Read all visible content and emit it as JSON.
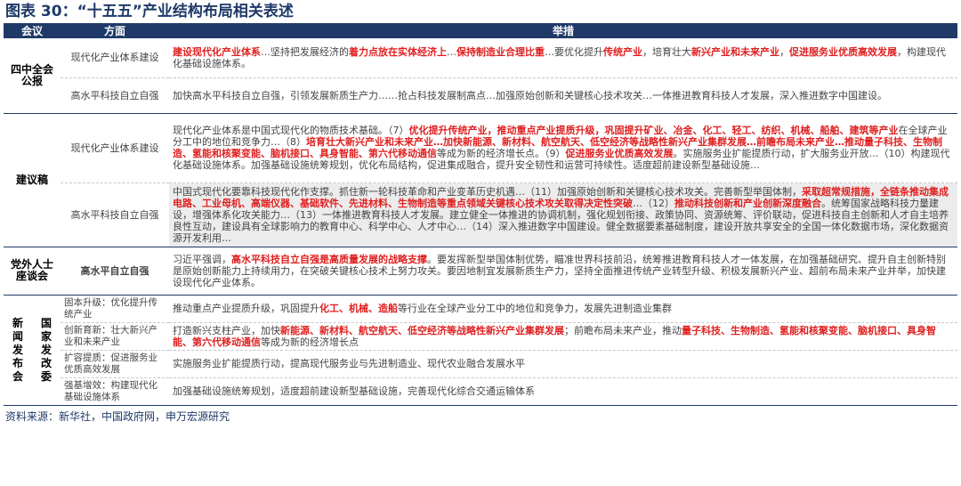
{
  "title": "图表 30：“十五五”产业结构布局相关表述",
  "headers": {
    "meeting": "会议",
    "aspect": "方面",
    "measures": "举措"
  },
  "rows": [
    {
      "meeting": "四中全会公报",
      "aspects": [
        {
          "aspect": "现代化产业体系建设",
          "segments": [
            {
              "t": "建设现代化产业体系",
              "hl": true
            },
            {
              "t": "…坚持把发展经济的",
              "hl": false
            },
            {
              "t": "着力点放在实体经济上",
              "hl": true
            },
            {
              "t": "…",
              "hl": false
            },
            {
              "t": "保持制造业合理比重",
              "hl": true
            },
            {
              "t": "…要优化提升",
              "hl": false
            },
            {
              "t": "传统产业",
              "hl": true
            },
            {
              "t": "，培育壮大",
              "hl": false
            },
            {
              "t": "新兴产业和未来产业",
              "hl": true
            },
            {
              "t": "，",
              "hl": false
            },
            {
              "t": "促进服务业优质高效发展",
              "hl": true
            },
            {
              "t": "，构建现代化基础设施体系。",
              "hl": false
            }
          ]
        },
        {
          "aspect": "高水平科技自立自强",
          "segments": [
            {
              "t": "加快高水平科技自立自强，引领发展新质生产力……抢占科技发展制高点…加强原始创新和关键核心技术攻关…一体推进教育科技人才发展，深入推进数字中国建设。",
              "hl": false
            }
          ]
        }
      ]
    },
    {
      "meeting": "建议稿",
      "aspects": [
        {
          "aspect": "现代化产业体系建设",
          "segments": [
            {
              "t": "现代化产业体系是中国式现代化的物质技术基础。（7）",
              "hl": false
            },
            {
              "t": "优化提升传统产业，推动重点产业提质升级，巩固提升矿业、冶金、化工、轻工、纺织、机械、船舶、建筑等产业",
              "hl": true
            },
            {
              "t": "在全球产业分工中的地位和竞争力…（8）",
              "hl": false
            },
            {
              "t": "培育壮大新兴产业和未来产业…加快新能源、新材料、航空航天、低空经济等战略性新兴产业集群发展…前瞻布局未来产业…推动量子科技、生物制造、氢能和核聚变能、脑机接口、具身智能、第六代移动通信",
              "hl": true
            },
            {
              "t": "等成为新的经济增长点。（9）",
              "hl": false
            },
            {
              "t": "促进服务业优质高效发展",
              "hl": true
            },
            {
              "t": "。实施服务业扩能提质行动，扩大服务业开放…（10）构建现代化基础设施体系。加强基础设施统筹规划，优化布局结构，促进集成融合，提升安全韧性和运营可持续性。适度超前建设新型基础设施…",
              "hl": false
            }
          ]
        },
        {
          "aspect": "高水平科技自立自强",
          "segments": [
            {
              "t": "中国式现代化要靠科技现代化作支撑。抓住新一轮科技革命和产业变革历史机遇…（11）加强原始创新和关键核心技术攻关。完善新型举国体制，",
              "hl": false
            },
            {
              "t": "采取超常规措施，全链条推动集成电路、工业母机、高端仪器、基础软件、先进材料、生物制造等重点领域关键核心技术攻关取得决定性突破",
              "hl": true
            },
            {
              "t": "…（12）",
              "hl": false
            },
            {
              "t": "推动科技创新和产业创新深度融合",
              "hl": true
            },
            {
              "t": "。统筹国家战略科技力量建设，增强体系化攻关能力…（13）一体推进教育科技人才发展。建立健全一体推进的协调机制，强化规划衔接、政策协同、资源统筹、评价联动，促进科技自主创新和人才自主培养良性互动，建设具有全球影响力的教育中心、科学中心、人才中心…（14）深入推进数字中国建设。健全数据要素基础制度，建设开放共享安全的全国一体化数据市场，深化数据资源开发利用…",
              "hl": false
            }
          ]
        }
      ]
    },
    {
      "meeting": "党外人士座谈会",
      "aspects": [
        {
          "aspect": "高水平自立自强",
          "aspect_hl": true,
          "segments": [
            {
              "t": "习近平强调，",
              "hl": false
            },
            {
              "t": "高水平科技自立自强是高质量发展的战略支撑",
              "hl": true
            },
            {
              "t": "。要发挥新型举国体制优势，瞄准世界科技前沿，统筹推进教育科技人才一体发展，在加强基础研究、提升自主创新特别是原始创新能力上持续用力，在突破关键核心技术上努力攻关。要因地制宜发展新质生产力，坚持全面推进传统产业转型升级、积极发展新兴产业、超前布局未来产业并举，加快建设现代化产业体系。",
              "hl": false
            }
          ]
        }
      ]
    },
    {
      "meeting_outer": "新闻发布会",
      "meeting_inner": "国家发改委",
      "aspects": [
        {
          "aspect": "固本升级：优化提升传统产业",
          "segments": [
            {
              "t": "推动重点产业提质升级，巩固提升",
              "hl": false
            },
            {
              "t": "化工、机械、造船",
              "hl": true
            },
            {
              "t": "等行业在全球产业分工中的地位和竞争力，发展先进制造业集群",
              "hl": false
            }
          ]
        },
        {
          "aspect": "创新育新：壮大新兴产业和未来产业",
          "segments": [
            {
              "t": "打造新兴支柱产业，加快",
              "hl": false
            },
            {
              "t": "新能源、新材料、航空航天、低空经济等战略性新兴产业集群发展",
              "hl": true
            },
            {
              "t": "；前瞻布局未来产业，推动",
              "hl": false
            },
            {
              "t": "量子科技、生物制造、氢能和核聚变能、脑机接口、具身智能、第六代移动通信",
              "hl": true
            },
            {
              "t": "等成为新的经济增长点",
              "hl": false
            }
          ]
        },
        {
          "aspect": "扩容提质：促进服务业优质高效发展",
          "segments": [
            {
              "t": "实施服务业扩能提质行动，提高现代服务业与先进制造业、现代农业融合发展水平",
              "hl": false
            }
          ]
        },
        {
          "aspect": "强基增效：构建现代化基础设施体系",
          "segments": [
            {
              "t": "加强基础设施统筹规划，适度超前建设新型基础设施，完善现代化综合交通运输体系",
              "hl": false
            }
          ]
        }
      ]
    }
  ],
  "source": "资料来源：新华社，中国政府网，申万宏源研究"
}
